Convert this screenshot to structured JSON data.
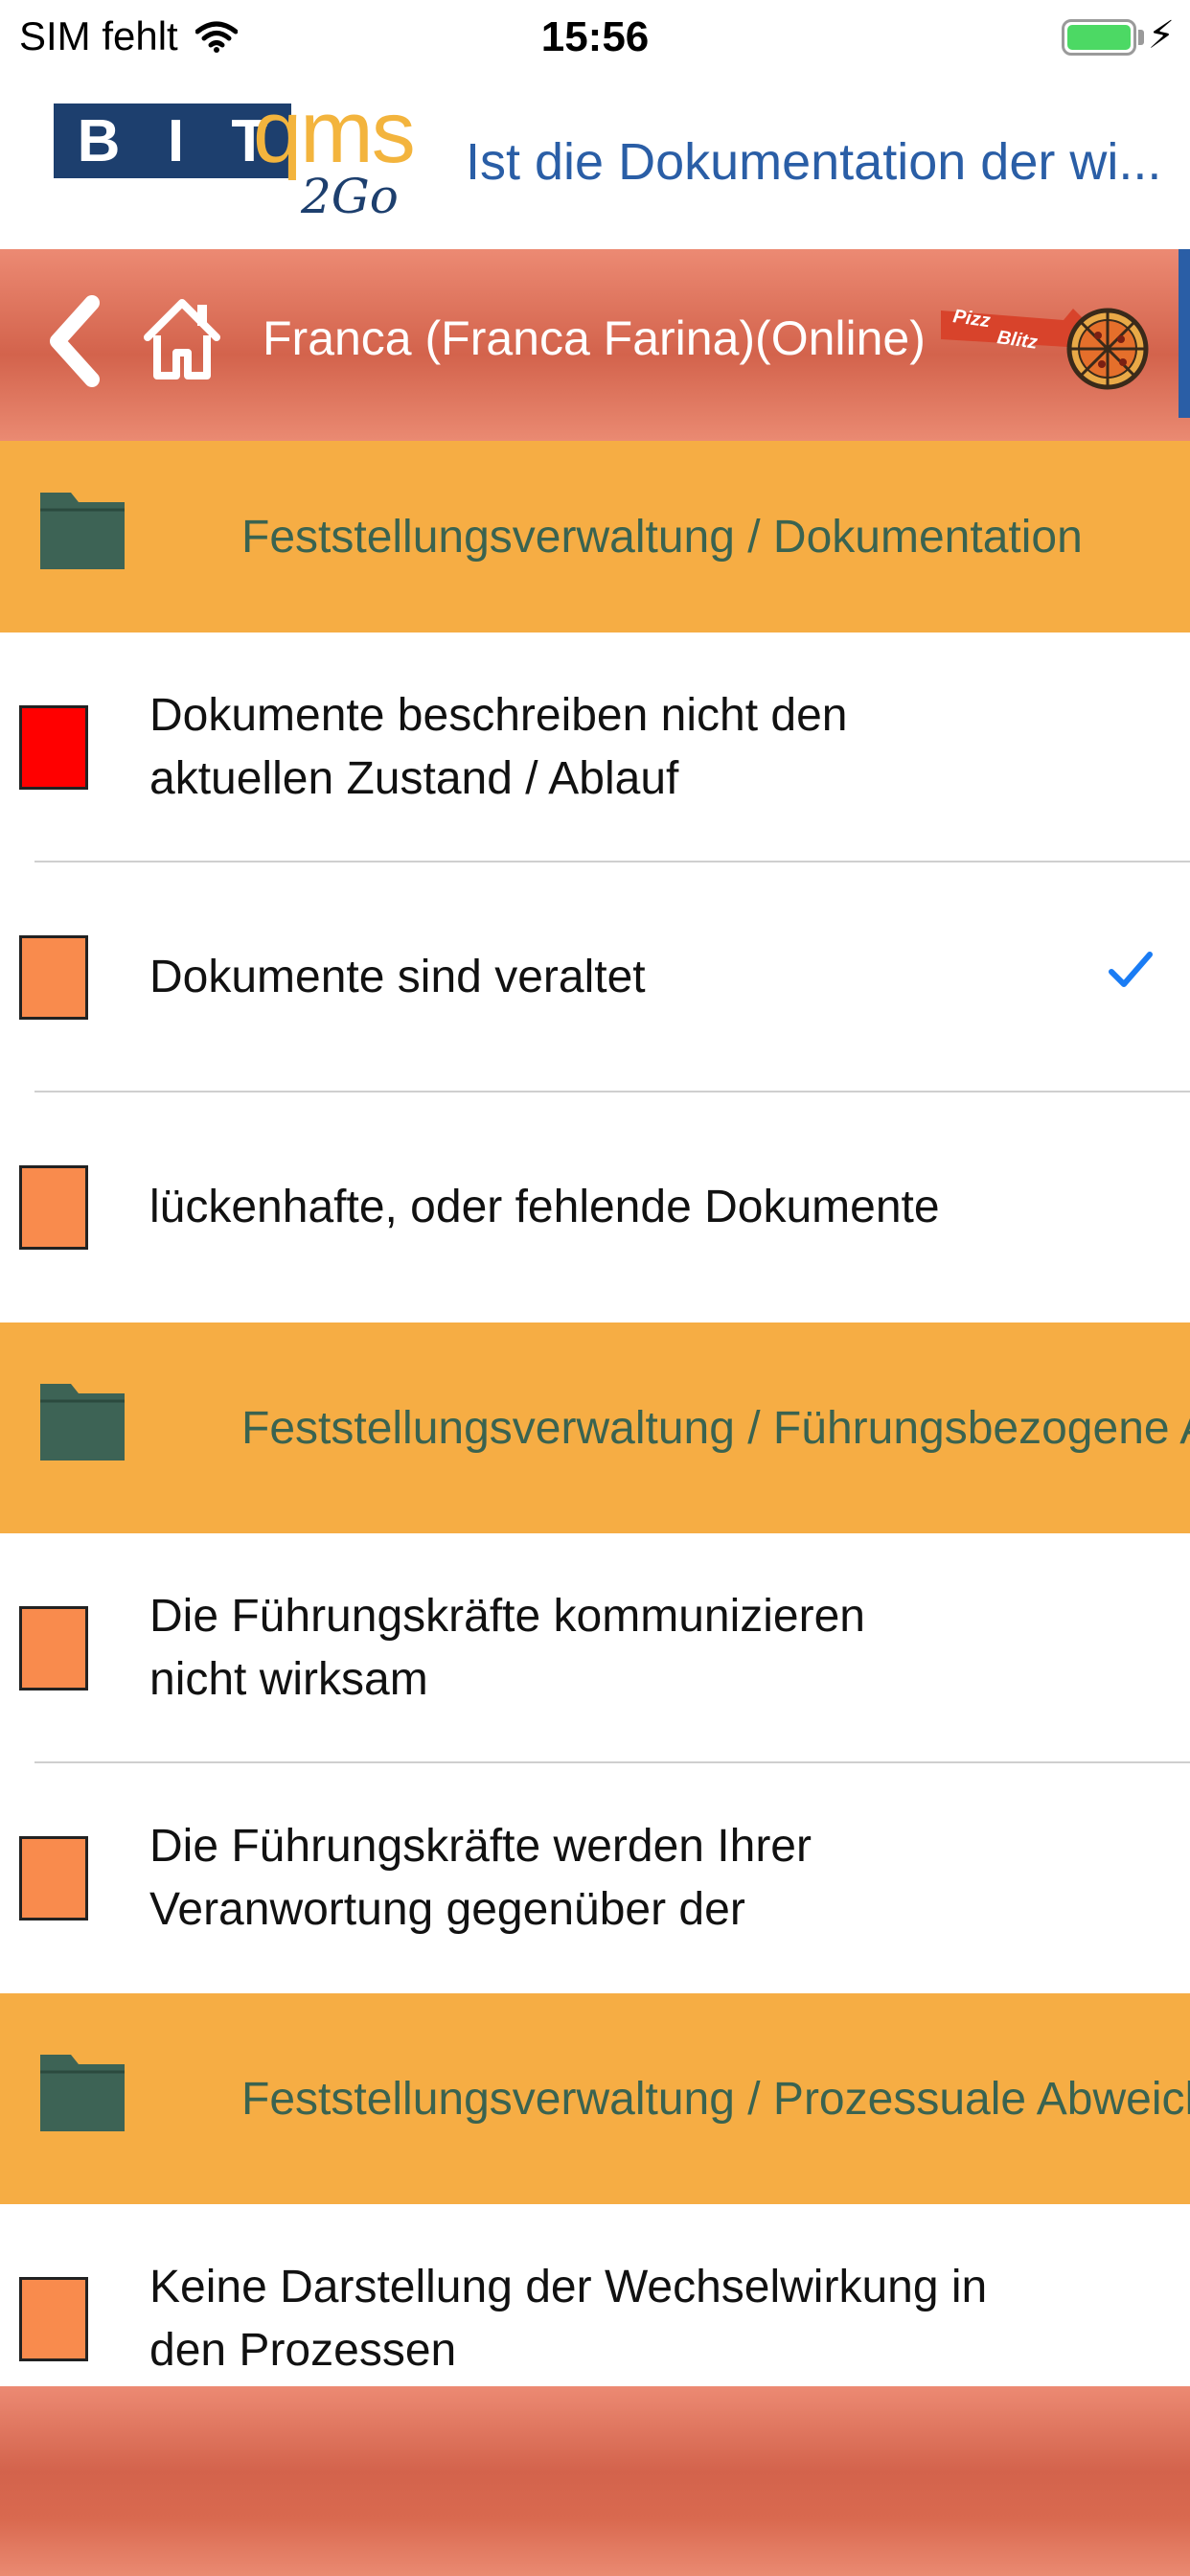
{
  "status_bar": {
    "carrier": "SIM fehlt",
    "time": "15:56"
  },
  "header": {
    "logo_bit": [
      "B",
      "I",
      "T"
    ],
    "logo_qms": "qms",
    "logo_2go": "2Go",
    "title": "Ist die Dokumentation der wi..."
  },
  "navbar": {
    "title": "Franca (Franca Farina)(Online)",
    "brand_logo_text": "Pizza Blitz"
  },
  "colors": {
    "section_bg": "#f6ad44",
    "nav_gradient_mid": "#d3634c",
    "severity_high": "#ff0000",
    "severity_medium": "#f98b4d",
    "check_blue": "#1a7cf4",
    "folder": "#3d6355"
  },
  "sections": [
    {
      "label": "Feststellungsverwaltung / Dokumentation",
      "icon": "folder-icon",
      "items": [
        {
          "label": "Dokumente beschreiben nicht den aktuellen Zustand / Ablauf",
          "severity": "high",
          "checked": false
        },
        {
          "label": "Dokumente sind veraltet",
          "severity": "medium",
          "checked": true
        },
        {
          "label": "lückenhafte, oder fehlende Dokumente",
          "severity": "medium",
          "checked": false
        }
      ]
    },
    {
      "label": "Feststellungsverwaltung / Führungsbezogene A",
      "icon": "folder-icon",
      "items": [
        {
          "label": "Die Führungskräfte kommunizieren nicht wirksam",
          "severity": "medium",
          "checked": false
        },
        {
          "label": "Die Führungskräfte werden Ihrer Veranwortung gegenüber der",
          "severity": "medium",
          "checked": false
        }
      ]
    },
    {
      "label": "Feststellungsverwaltung / Prozessuale Abweich",
      "icon": "folder-icon",
      "items": [
        {
          "label": "Keine Darstellung der Wechselwirkung in den Prozessen",
          "severity": "medium",
          "checked": false
        }
      ]
    }
  ]
}
